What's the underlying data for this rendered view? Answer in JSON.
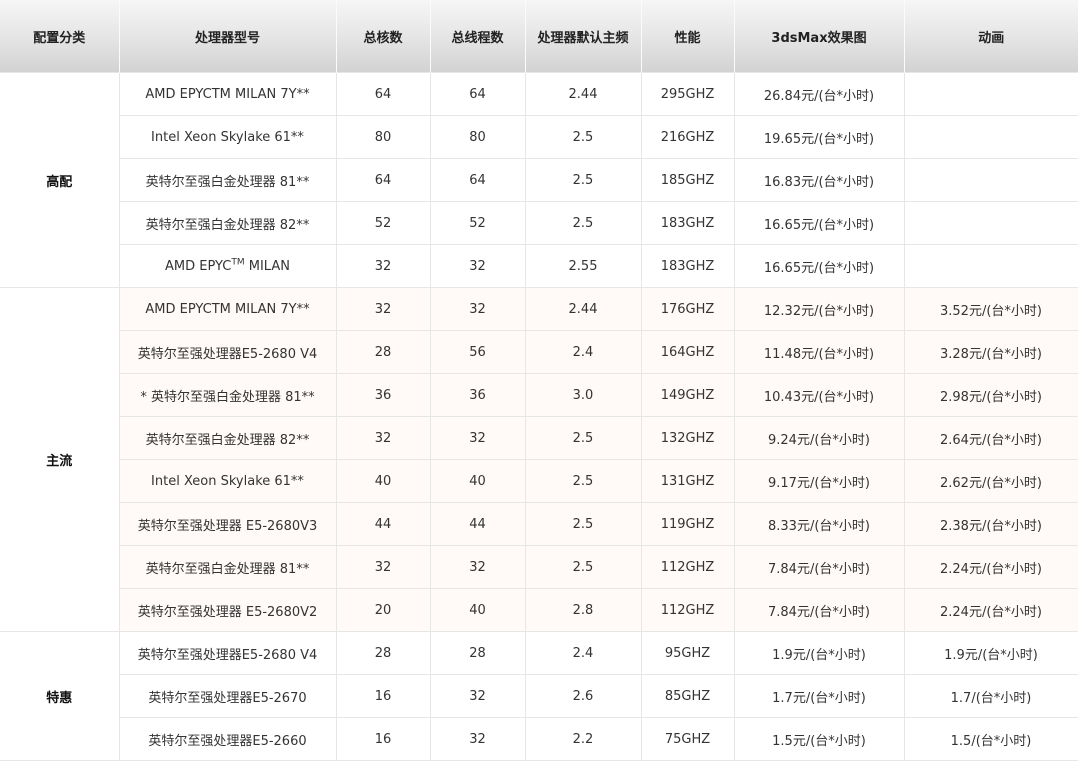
{
  "headers": [
    "配置分类",
    "处理器型号",
    "总核数",
    "总线程数",
    "处理器默认主频",
    "性能",
    "3dsMax效果图",
    "动画"
  ],
  "groups": [
    {
      "category": "高配",
      "rows": [
        {
          "model": "AMD EPYCTM MILAN 7Y**",
          "cores": "64",
          "threads": "64",
          "freq": "2.44",
          "perf": "295GHZ",
          "max": "26.84元/(台*小时)",
          "anim": ""
        },
        {
          "model": "Intel Xeon Skylake 61**",
          "cores": "80",
          "threads": "80",
          "freq": "2.5",
          "perf": "216GHZ",
          "max": "19.65元/(台*小时)",
          "anim": ""
        },
        {
          "model": "英特尔至强白金处理器 81**",
          "cores": "64",
          "threads": "64",
          "freq": "2.5",
          "perf": "185GHZ",
          "max": "16.83元/(台*小时)",
          "anim": ""
        },
        {
          "model": "英特尔至强白金处理器 82**",
          "cores": "52",
          "threads": "52",
          "freq": "2.5",
          "perf": "183GHZ",
          "max": "16.65元/(台*小时)",
          "anim": ""
        },
        {
          "model_prefix": "AMD EPYC",
          "model_sup": "TM",
          "model_suffix": " MILAN",
          "cores": "32",
          "threads": "32",
          "freq": "2.55",
          "perf": "183GHZ",
          "max": "16.65元/(台*小时)",
          "anim": ""
        }
      ]
    },
    {
      "category": "主流",
      "rows": [
        {
          "model": "AMD EPYCTM MILAN 7Y**",
          "cores": "32",
          "threads": "32",
          "freq": "2.44",
          "perf": "176GHZ",
          "max": "12.32元/(台*小时)",
          "anim": "3.52元/(台*小时)"
        },
        {
          "model": "英特尔至强处理器E5-2680 V4",
          "cores": "28",
          "threads": "56",
          "freq": "2.4",
          "perf": "164GHZ",
          "max": "11.48元/(台*小时)",
          "anim": "3.28元/(台*小时)"
        },
        {
          "model": "* 英特尔至强白金处理器 81**",
          "cores": "36",
          "threads": "36",
          "freq": "3.0",
          "perf": "149GHZ",
          "max": "10.43元/(台*小时)",
          "anim": "2.98元/(台*小时)"
        },
        {
          "model": "英特尔至强白金处理器 82**",
          "cores": "32",
          "threads": "32",
          "freq": "2.5",
          "perf": "132GHZ",
          "max": "9.24元/(台*小时)",
          "anim": "2.64元/(台*小时)"
        },
        {
          "model": "Intel Xeon Skylake 61**",
          "cores": "40",
          "threads": "40",
          "freq": "2.5",
          "perf": "131GHZ",
          "max": "9.17元/(台*小时)",
          "anim": "2.62元/(台*小时)"
        },
        {
          "model": "英特尔至强处理器 E5-2680V3",
          "cores": "44",
          "threads": "44",
          "freq": "2.5",
          "perf": "119GHZ",
          "max": "8.33元/(台*小时)",
          "anim": "2.38元/(台*小时)"
        },
        {
          "model": "英特尔至强白金处理器 81**",
          "cores": "32",
          "threads": "32",
          "freq": "2.5",
          "perf": "112GHZ",
          "max": "7.84元/(台*小时)",
          "anim": "2.24元/(台*小时)"
        },
        {
          "model": "英特尔至强处理器 E5-2680V2",
          "cores": "20",
          "threads": "40",
          "freq": "2.8",
          "perf": "112GHZ",
          "max": "7.84元/(台*小时)",
          "anim": "2.24元/(台*小时)"
        }
      ]
    },
    {
      "category": "特惠",
      "rows": [
        {
          "model": "英特尔至强处理器E5-2680 V4",
          "cores": "28",
          "threads": "28",
          "freq": "2.4",
          "perf": "95GHZ",
          "max": "1.9元/(台*小时)",
          "anim": "1.9元/(台*小时)"
        },
        {
          "model": "英特尔至强处理器E5-2670",
          "cores": "16",
          "threads": "32",
          "freq": "2.6",
          "perf": "85GHZ",
          "max": "1.7元/(台*小时)",
          "anim": "1.7/(台*小时)"
        },
        {
          "model": "英特尔至强处理器E5-2660",
          "cores": "16",
          "threads": "32",
          "freq": "2.2",
          "perf": "75GHZ",
          "max": "1.5元/(台*小时)",
          "anim": "1.5/(台*小时)"
        }
      ]
    }
  ]
}
